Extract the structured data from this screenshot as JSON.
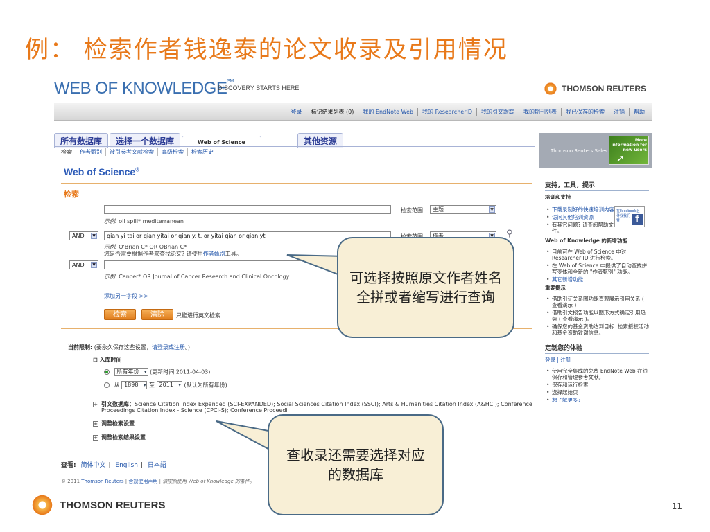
{
  "slide_title": "例： 检索作者钱逸泰的论文收录及引用情况",
  "page_number": "11",
  "bottom_logo_text": "THOMSON REUTERS",
  "header": {
    "logo_text": "WEB OF KNOWLEDGE",
    "logo_sm": "SM",
    "tagline": "DISCOVERY STARTS HERE",
    "tr_logo_text": "THOMSON REUTERS"
  },
  "navbar": {
    "links": [
      "登录",
      "标记结果列表 (0)",
      "我的 EndNote Web",
      "我的 ResearcherID",
      "我的引文跟踪",
      "我的期刊列表",
      "我已保存的检索",
      "注销",
      "帮助"
    ]
  },
  "tabs": {
    "all_db": "所有数据库",
    "select_db": "选择一个数据库",
    "wos": "Web of Science",
    "other": "其他资源"
  },
  "subtabs": [
    "检索",
    "作者甄别",
    "被引参考文献检索",
    "高级检索",
    "检索历史"
  ],
  "wos_title": "Web of Science",
  "wos_reg": "®",
  "search": {
    "heading": "检索",
    "row1": {
      "value": "",
      "example": "oil spill* mediterranean",
      "example_prefix": "示例:",
      "scope_label": "检索范围",
      "scope_value": "主题"
    },
    "row2": {
      "bool": "AND",
      "value": "qian yi tai or qian yitai or qian y. t. or yitai qian or qian yt",
      "example_prefix": "示例:",
      "example": "O'Brian C* OR OBrian C*",
      "help_prefix": "您是否需要根据作者来查找论文? 请使用",
      "help_link": "作者甄别",
      "help_suffix": "工具。",
      "scope_label": "检索范围",
      "scope_value": "作者"
    },
    "row3": {
      "bool": "AND",
      "value": "",
      "example_prefix": "示例:",
      "example": "Cancer* OR Journal of Cancer Research and Clinical Oncology"
    },
    "add_field": "添加另一字段 >>",
    "search_btn": "检索",
    "clear_btn": "清除",
    "english_only": "只能进行英文检索"
  },
  "limits": {
    "label": "当前限制:",
    "hint_prefix": "(要永久保存这些设置，",
    "hint_link": "请登录或注册",
    "hint_suffix": "。)",
    "timespan_label": "入库时间",
    "all_years": "所有年份",
    "updated": "(更新时间 2011-04-03)",
    "from_label": "从",
    "from_year": "1898",
    "to_label": "至",
    "to_year": "2011",
    "default_note": "(默认为所有年份)",
    "citation_db_label": "引文数据库：",
    "citation_db_text": "Science Citation Index Expanded (SCI-EXPANDED); Social Sciences Citation Index (SSCI); Arts & Humanities Citation Index (A&HCI); Conference",
    "citation_db_text2": "Proceedings Citation Index - Science (CPCI-S); Conference Proceedi",
    "adjust_search": "调整检索设置",
    "adjust_results": "调整检索结果设置"
  },
  "lang_bar": {
    "label": "查看:",
    "trad_chinese": "简体中文",
    "english": "English",
    "japanese": "日本語"
  },
  "footer": {
    "copyright": "© 2011",
    "copyright_link": "Thomson Reuters",
    "terms": "合规使用声明",
    "note": "请按照使用 Web of Knowledge 的条件。"
  },
  "right": {
    "promo_text": "Thomson Reuters Sales",
    "promo_green": "More information for new users",
    "support_title": "支持，工具，提示",
    "training_title": "培训和支持",
    "support_items": [
      "下载录制好的快速培训内容",
      "访问其他培训资源",
      "有其它问题? 请查阅帮助文件。"
    ],
    "fb_text": "在Facebook上寻找我们",
    "fb_like": "赞",
    "new_title": "Web of Knowledge 的新增功能",
    "new_items": [
      "目前可在 Web of Science 中对 Researcher ID 进行检索。",
      "在 Web of Science 中提供了自动查找拼写变体和全新的 \"作者甄别\" 功能。",
      "其它新增功能"
    ],
    "tips_title": "重要提示",
    "tips_items": [
      "借助引证关系图功能直观展示引用关系 ( 查看演示 )",
      "借助引文报告功能以图形方式确定引用趋势 ( 查看演示 )。",
      "确保您的基金资助达到目标: 检索授权活动和基金资助致谢信息。"
    ],
    "custom_title": "定制您的体验",
    "custom_links": "登录 | 注册",
    "custom_items": [
      "使用完全集成的免费 EndNote Web 在线保存和管理参考文献。",
      "保存和运行检索",
      "选择起始页",
      "想了解更多?"
    ]
  },
  "callouts": {
    "top": "可选择按照原文作者姓名全拼或者缩写进行查询",
    "bottom": "查收录还需要选择对应的数据库"
  }
}
